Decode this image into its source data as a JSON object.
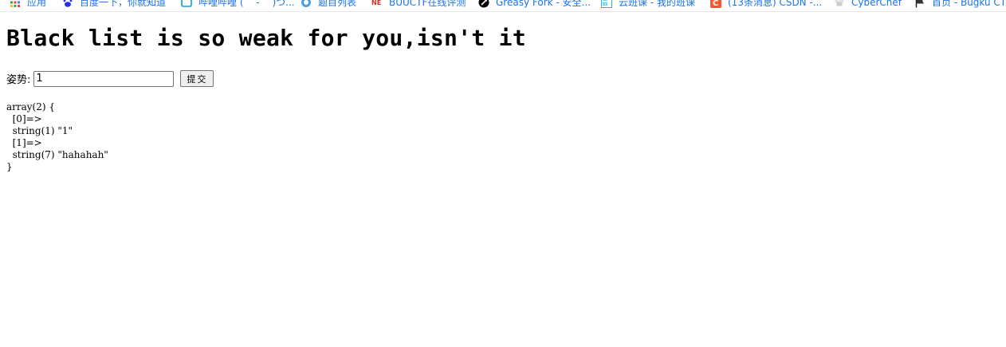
{
  "bookmarks": [
    {
      "label": "应用",
      "icon": "apps-grid-icon"
    },
    {
      "label": "百度一下，你就知道",
      "icon": "baidu-paw-icon"
    },
    {
      "label": "哔哩哔哩 ( ゜- ゜)つ...",
      "icon": "bilibili-tv-icon"
    },
    {
      "label": "题目列表",
      "icon": "circle-logo-icon"
    },
    {
      "label": "BUUCTF在线评测",
      "icon": "buuctf-icon"
    },
    {
      "label": "Greasy Fork - 安全...",
      "icon": "greasyfork-icon"
    },
    {
      "label": "云班课 - 我的班课",
      "icon": "cloud-class-icon"
    },
    {
      "label": "(13条消息) CSDN -...",
      "icon": "csdn-icon"
    },
    {
      "label": "CyberChef",
      "icon": "chef-hat-icon"
    },
    {
      "label": "首页 - Bugku CTF",
      "icon": "flag-icon"
    }
  ],
  "page": {
    "title": "Black list is so weak for you,isn't it",
    "form": {
      "label": "姿势:",
      "input_value": "1",
      "submit_label": "提交"
    },
    "dump_lines": [
      "array(2) {",
      "  [0]=>",
      "  string(1) \"1\"",
      "  [1]=>",
      "  string(7) \"hahahah\"",
      "}"
    ]
  },
  "colors": {
    "bookmark_text": "#1a73e8",
    "page_text": "#000000",
    "background": "#ffffff"
  }
}
